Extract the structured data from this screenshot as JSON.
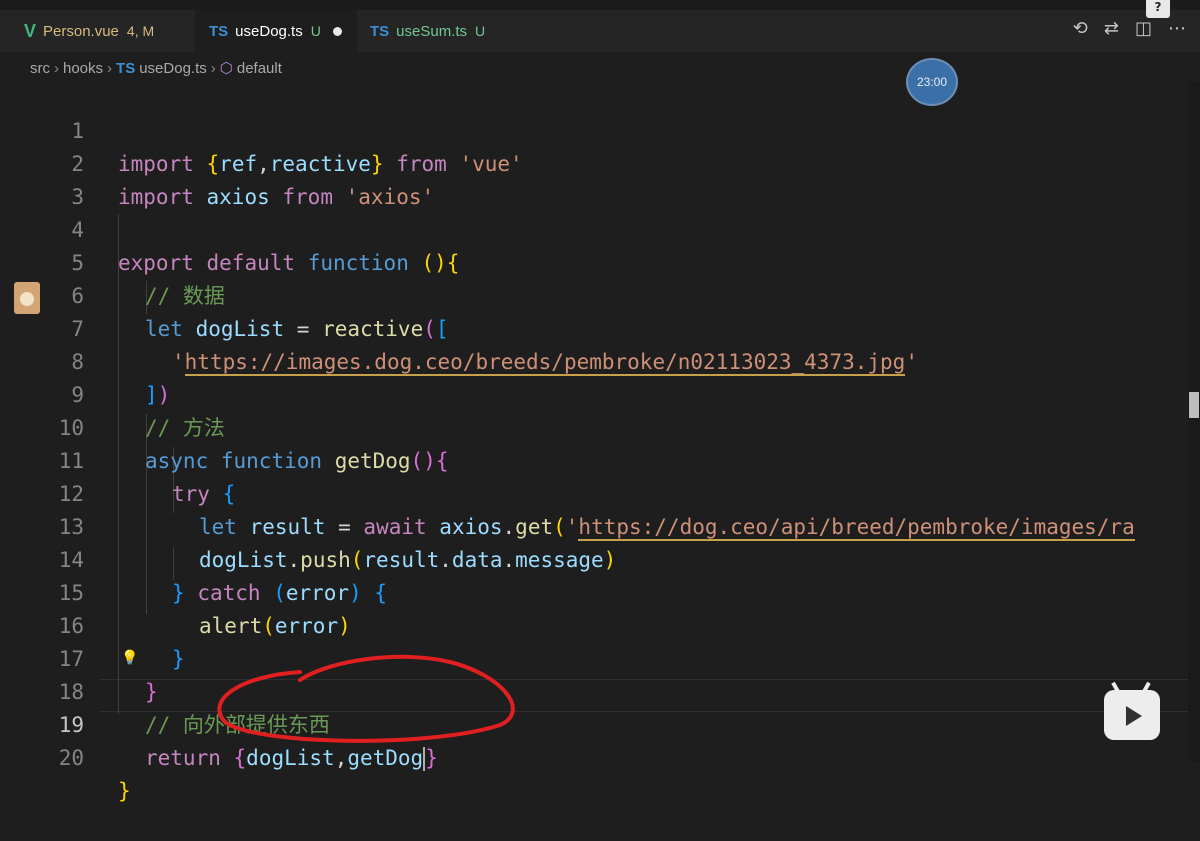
{
  "tabs": [
    {
      "label": "Person.vue",
      "icon": "V",
      "status": "4, M",
      "active": false
    },
    {
      "label": "useDog.ts",
      "icon": "TS",
      "status": "U",
      "active": true
    },
    {
      "label": "useSum.ts",
      "icon": "TS",
      "status": "U",
      "active": false
    }
  ],
  "toolbar": {
    "help": "?",
    "icons": [
      "history-icon",
      "compare-icon",
      "split-editor-icon",
      "more-icon"
    ]
  },
  "breadcrumb": {
    "items": [
      "src",
      "hooks",
      "useDog.ts",
      "default"
    ],
    "file_icon": "TS"
  },
  "timer": {
    "text": "23:00"
  },
  "editor": {
    "current_line": 19,
    "lines": [
      {
        "n": "1"
      },
      {
        "n": "2"
      },
      {
        "n": "3"
      },
      {
        "n": "4"
      },
      {
        "n": "5"
      },
      {
        "n": "6"
      },
      {
        "n": "7"
      },
      {
        "n": "8"
      },
      {
        "n": "9"
      },
      {
        "n": "10"
      },
      {
        "n": "11"
      },
      {
        "n": "12"
      },
      {
        "n": "13"
      },
      {
        "n": "14"
      },
      {
        "n": "15"
      },
      {
        "n": "16"
      },
      {
        "n": "17"
      },
      {
        "n": "18"
      },
      {
        "n": "19"
      },
      {
        "n": "20"
      }
    ],
    "code": {
      "l1": [
        "import",
        "{",
        "ref",
        ",",
        "reactive",
        "}",
        "from",
        "'vue'"
      ],
      "l2": [
        "import",
        "axios",
        "from",
        "'axios'"
      ],
      "l4": [
        "export",
        "default",
        "function",
        "(){"
      ],
      "l5": "// 数据",
      "l6": [
        "let",
        "dogList",
        "=",
        "reactive",
        "(",
        "["
      ],
      "l7": [
        "'",
        "https://images.dog.ceo/breeds/pembroke/n02113023_4373.jpg",
        "'"
      ],
      "l8": [
        "]",
        ")"
      ],
      "l9": "// 方法",
      "l10": [
        "async",
        "function",
        "getDog",
        "()",
        "{"
      ],
      "l11": [
        "try",
        "{"
      ],
      "l12": [
        "let",
        "result",
        "=",
        "await",
        "axios",
        ".",
        "get",
        "(",
        "'",
        "https://dog.ceo/api/breed/pembroke/images/ra"
      ],
      "l13": [
        "dogList",
        ".",
        "push",
        "(",
        "result",
        ".",
        "data",
        ".",
        "message",
        ")"
      ],
      "l14": [
        "}",
        "catch",
        "(",
        "error",
        ")",
        "{"
      ],
      "l15": [
        "alert",
        "(",
        "error",
        ")"
      ],
      "l16": "}",
      "l17": "}",
      "l18": "// 向外部提供东西",
      "l19": [
        "return",
        "{",
        "dogList",
        ",",
        "getDog",
        "}"
      ],
      "l20": "}"
    }
  },
  "overlay": {
    "watermark_icon": "bilibili-icon",
    "annotation": "red-circle-annotation"
  },
  "colors": {
    "accent": "#3c8fd5",
    "annotation": "#e02020"
  }
}
